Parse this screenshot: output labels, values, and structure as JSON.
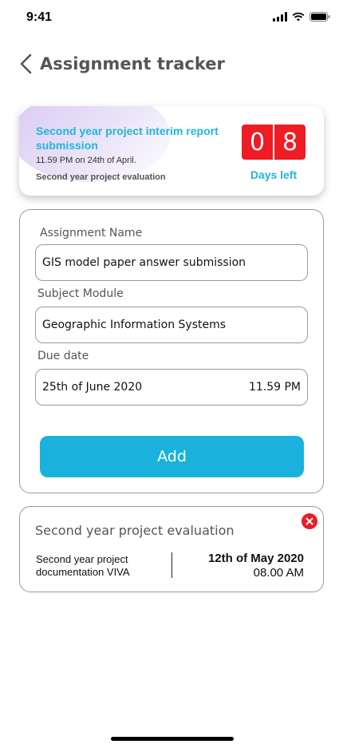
{
  "status_bar": {
    "time": "9:41",
    "icons": [
      "signal-icon",
      "wifi-icon",
      "battery-icon"
    ]
  },
  "nav": {
    "back_icon": "chevron-left-icon",
    "title": "Assignment tracker"
  },
  "deadline": {
    "title": "Second year project interim report submission",
    "time": "11.59 PM on 24th of April.",
    "subtitle": "Second year project evaluation",
    "days_digits": [
      "0",
      "8"
    ],
    "days_label": "Days left",
    "accent_color": "#1fb6d8",
    "digit_color": "#ee1c24"
  },
  "form": {
    "assignment_name_label": "Assignment Name",
    "assignment_name_value": "GIS model paper answer submission",
    "subject_module_label": "Subject Module",
    "subject_module_value": "Geographic Information Systems",
    "due_date_label": "Due date",
    "due_date_value": "25th of June 2020",
    "due_time_value": "11.59 PM",
    "add_button_label": "Add",
    "button_color": "#1ab2dc"
  },
  "evaluation": {
    "title": "Second year project evaluation",
    "close_icon": "close-icon",
    "description": "Second year project documentation VIVA",
    "date": "12th of May 2020",
    "time": "08.00 AM"
  }
}
